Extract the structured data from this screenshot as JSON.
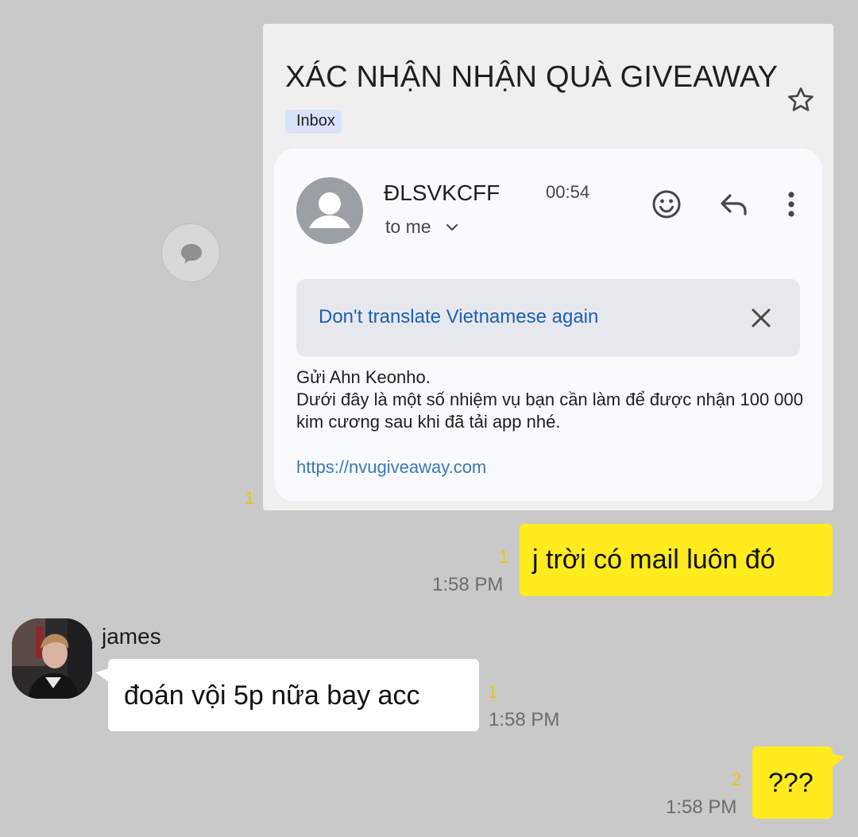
{
  "email": {
    "subject": "XÁC NHẬN NHẬN QUÀ GIVEAWAY",
    "label": "Inbox",
    "sender": "ĐLSVKCFF",
    "time": "00:54",
    "recipient": "to me",
    "translate_prompt": "Don't translate Vietnamese again",
    "body": "Gửi Ahn Keonho.\nDưới đây là một số nhiệm vụ bạn cần làm để được nhận 100 000 kim cương sau khi đã tải app nhé.",
    "link": "https://nvugiveaway.com",
    "unread": "1"
  },
  "messages": [
    {
      "sender": "me",
      "text": "j trời có mail luôn đó",
      "time": "1:58 PM",
      "unread": "1"
    },
    {
      "sender": "james",
      "name": "james",
      "text": "đoán vội 5p nữa bay acc",
      "time": "1:58 PM",
      "unread": "1"
    },
    {
      "sender": "me",
      "text": "???",
      "time": "1:58 PM",
      "unread": "2"
    }
  ],
  "colors": {
    "background": "#c9c9c9",
    "my_bubble": "#ffeb1e",
    "other_bubble": "#ffffff",
    "unread_count": "#e9c800"
  },
  "icons": [
    "share-icon",
    "star-icon",
    "sender-avatar-icon",
    "chevron-down-icon",
    "emoji-icon",
    "reply-icon",
    "more-vert-icon",
    "close-icon"
  ]
}
